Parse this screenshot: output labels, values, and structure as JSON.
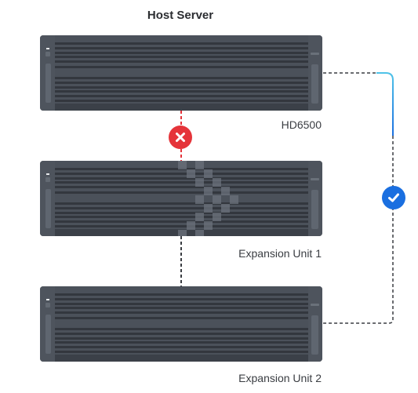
{
  "diagram": {
    "title": "Host Server",
    "nodes": [
      {
        "id": "host",
        "label": "HD6500",
        "role": "host-server"
      },
      {
        "id": "exp1",
        "label": "Expansion Unit 1",
        "role": "expansion-unit"
      },
      {
        "id": "exp2",
        "label": "Expansion Unit 2",
        "role": "expansion-unit"
      }
    ],
    "connections": [
      {
        "from": "host",
        "to": "exp1",
        "status": "failed",
        "icon": "error-x-icon",
        "color": "#e5343a"
      },
      {
        "from": "host",
        "to": "exp2",
        "status": "connected",
        "icon": "check-icon",
        "color": "#1a6fe0"
      },
      {
        "from": "exp1",
        "to": "exp2",
        "status": "cabled",
        "style": "dashed"
      }
    ],
    "colors": {
      "server_body": "#4b515a",
      "error": "#e5343a",
      "success": "#1a6fe0",
      "active_line_start": "#4fc3e8",
      "active_line_end": "#1a6fe0",
      "dashed_line": "#3a3d42"
    }
  }
}
